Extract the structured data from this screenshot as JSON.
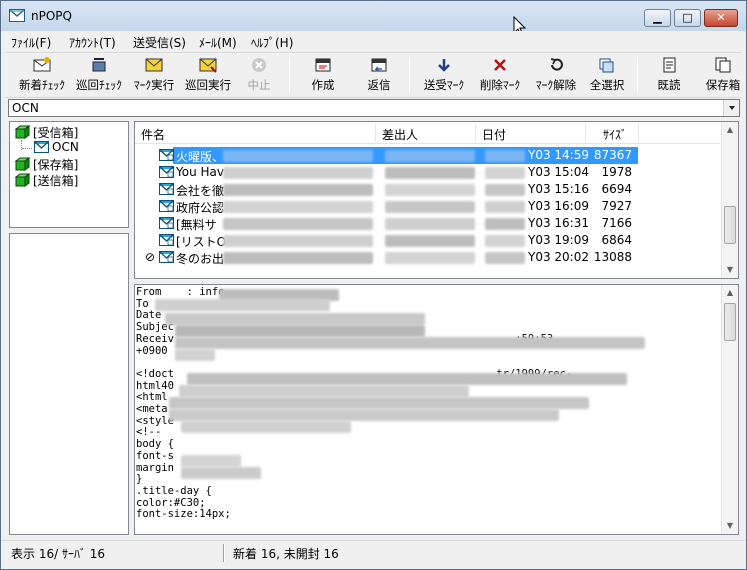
{
  "window": {
    "title": "nPOPQ"
  },
  "menu": [
    "ﾌｧｲﾙ(F)",
    "ｱｶｳﾝﾄ(T)",
    "送受信(S)",
    "ﾒｰﾙ(M)",
    "ﾍﾙﾌﾟ(H)"
  ],
  "toolbar": {
    "new_check": "新着ﾁｪｯｸ",
    "cycle_check": "巡回ﾁｪｯｸ",
    "mark_exec": "ﾏｰｸ実行",
    "cycle_exec": "巡回実行",
    "stop": "中止",
    "compose": "作成",
    "reply": "返信",
    "send_mark": "送受ﾏｰｸ",
    "delete_mark": "削除ﾏｰｸ",
    "unmark": "ﾏｰｸ解除",
    "select_all": "全選択",
    "read": "既読",
    "save_box": "保存箱"
  },
  "account": {
    "selected": "OCN"
  },
  "tree": {
    "inbox": "[受信箱]",
    "ocn": "OCN",
    "save_box": "[保存箱]",
    "sent_box": "[送信箱]"
  },
  "list": {
    "headers": {
      "subject": "件名",
      "from": "差出人",
      "date": "日付",
      "size": "ｻｲｽﾞ"
    },
    "rows": [
      {
        "subject": "火曜版、",
        "date": "Y03 14:59",
        "size": "87367",
        "selected": true,
        "attach": false
      },
      {
        "subject": "You Hav",
        "date": "Y03 15:04",
        "size": "1978",
        "selected": false,
        "attach": false
      },
      {
        "subject": "会社を徹",
        "date": "Y03 15:16",
        "size": "6694",
        "selected": false,
        "attach": false
      },
      {
        "subject": "政府公認",
        "date": "Y03 16:09",
        "size": "7927",
        "selected": false,
        "attach": false
      },
      {
        "subject": "[無料サ",
        "date": "Y03 16:31",
        "size": "7166",
        "selected": false,
        "attach": false
      },
      {
        "subject": "[リストO",
        "date": "Y03 19:09",
        "size": "6864",
        "selected": false,
        "attach": false
      },
      {
        "subject": "冬のお出",
        "date": "Y03 20:02",
        "size": "13088",
        "selected": false,
        "attach": true
      }
    ]
  },
  "preview": {
    "lines": [
      "From    : info",
      "To",
      "Date",
      "Subjec",
      "Receiv                                                      :59:53",
      "+0900",
      "",
      "<!doct                                                   tr/1999/rec-",
      "html40",
      "<html",
      "<meta",
      "<style",
      "<!--",
      "body {",
      "font-s",
      "margin",
      "}",
      ".title-day {",
      "color:#C30;",
      "font-size:14px;"
    ]
  },
  "status": {
    "left": "表示 16/ ｻｰﾊﾞ 16",
    "right": "新着 16, 未開封 16"
  }
}
